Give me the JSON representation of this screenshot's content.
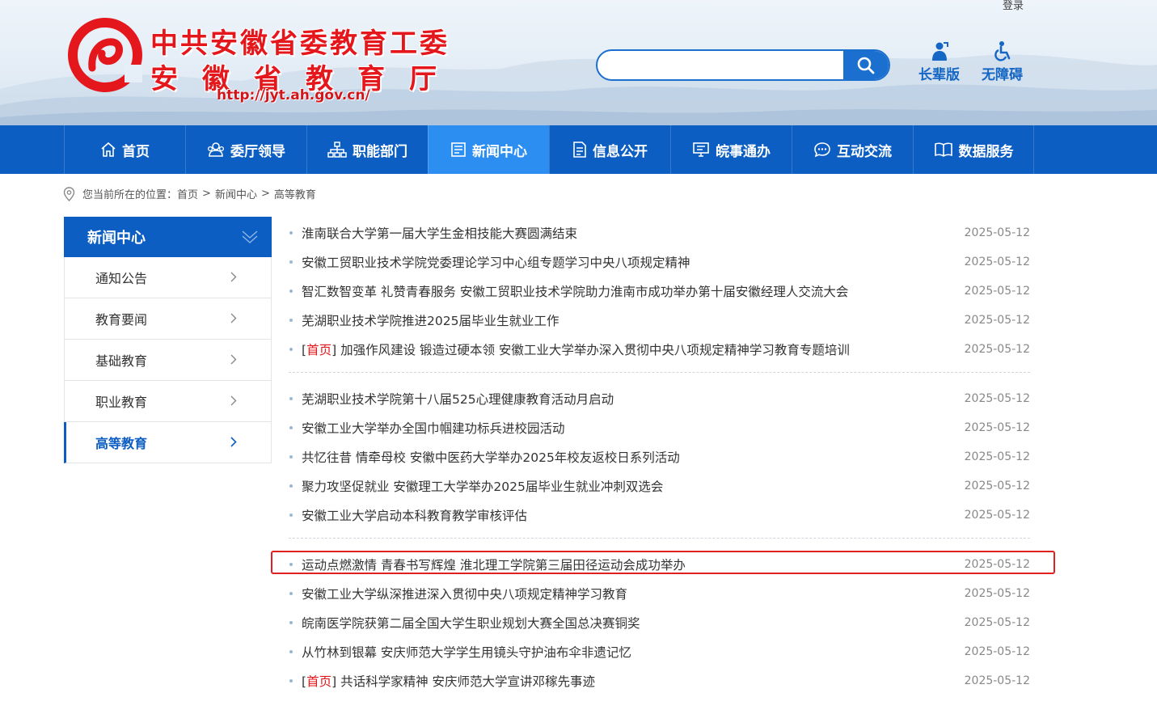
{
  "header": {
    "login": "登录",
    "title_line1": "中共安徽省委教育工委",
    "title_line2": "安徽省教育厅",
    "url": "http://jyt.ah.gov.cn/",
    "search_placeholder": "",
    "tools": [
      {
        "label": "长辈版",
        "icon": "elder-user-icon"
      },
      {
        "label": "无障碍",
        "icon": "wheelchair-icon"
      }
    ]
  },
  "colors": {
    "nav_bg": "#0c5ec2",
    "nav_active": "#2b8ef0",
    "brand_red": "#e3171c",
    "highlight": "#e02020"
  },
  "nav": [
    {
      "label": "首页",
      "icon": "home-icon"
    },
    {
      "label": "委厅领导",
      "icon": "people-icon"
    },
    {
      "label": "职能部门",
      "icon": "org-chart-icon"
    },
    {
      "label": "新闻中心",
      "icon": "news-icon",
      "active": true
    },
    {
      "label": "信息公开",
      "icon": "document-icon"
    },
    {
      "label": "皖事通办",
      "icon": "monitor-icon"
    },
    {
      "label": "互动交流",
      "icon": "chat-icon"
    },
    {
      "label": "数据服务",
      "icon": "book-icon"
    }
  ],
  "breadcrumb": {
    "prefix": "您当前所在的位置：",
    "items": [
      "首页",
      "新闻中心",
      "高等教育"
    ],
    "separator": ">"
  },
  "sidebar": {
    "heading": "新闻中心",
    "items": [
      {
        "label": "通知公告"
      },
      {
        "label": "教育要闻"
      },
      {
        "label": "基础教育"
      },
      {
        "label": "职业教育"
      },
      {
        "label": "高等教育",
        "active": true
      }
    ]
  },
  "news": [
    {
      "title": "淮南联合大学第一届大学生金相技能大赛圆满结束",
      "date": "2025-05-12"
    },
    {
      "title": "安徽工贸职业技术学院党委理论学习中心组专题学习中央八项规定精神",
      "date": "2025-05-12"
    },
    {
      "title": "智汇数智变革 礼赞青春服务 安徽工贸职业技术学院助力淮南市成功举办第十届安徽经理人交流大会",
      "date": "2025-05-12"
    },
    {
      "title": "芜湖职业技术学院推进2025届毕业生就业工作",
      "date": "2025-05-12"
    },
    {
      "tag": "首页",
      "title": "加强作风建设 锻造过硬本领 安徽工业大学举办深入贯彻中央八项规定精神学习教育专题培训",
      "date": "2025-05-12"
    },
    {
      "title": "芜湖职业技术学院第十八届525心理健康教育活动月启动",
      "date": "2025-05-12"
    },
    {
      "title": "安徽工业大学举办全国巾帼建功标兵进校园活动",
      "date": "2025-05-12"
    },
    {
      "title": "共忆往昔 情牵母校 安徽中医药大学举办2025年校友返校日系列活动",
      "date": "2025-05-12"
    },
    {
      "title": "聚力攻坚促就业 安徽理工大学举办2025届毕业生就业冲刺双选会",
      "date": "2025-05-12"
    },
    {
      "title": "安徽工业大学启动本科教育教学审核评估",
      "date": "2025-05-12"
    },
    {
      "title": "运动点燃激情 青春书写辉煌 淮北理工学院第三届田径运动会成功举办",
      "date": "2025-05-12",
      "highlighted": true
    },
    {
      "title": "安徽工业大学纵深推进深入贯彻中央八项规定精神学习教育",
      "date": "2025-05-12"
    },
    {
      "title": "皖南医学院获第二届全国大学生职业规划大赛全国总决赛铜奖",
      "date": "2025-05-12"
    },
    {
      "title": "从竹林到银幕 安庆师范大学学生用镜头守护油布伞非遗记忆",
      "date": "2025-05-12"
    },
    {
      "tag": "首页",
      "title": "共话科学家精神 安庆师范大学宣讲邓稼先事迹",
      "date": "2025-05-12"
    }
  ]
}
